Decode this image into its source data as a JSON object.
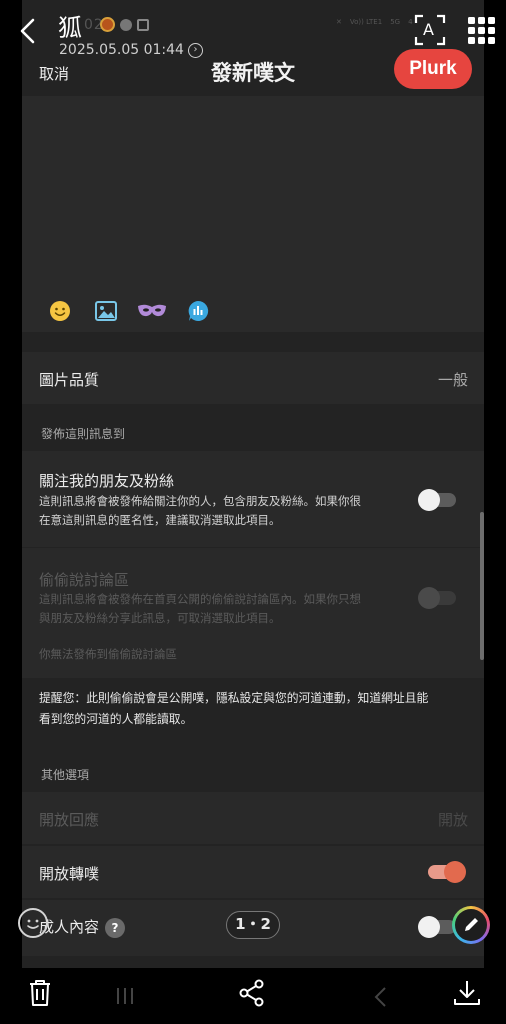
{
  "viewer": {
    "title": "狐",
    "date": "2025.05.05 01:44",
    "ghost_status": "02",
    "ghost_system": [
      "Vo)) LTE1",
      "5G",
      "4"
    ],
    "text_scan_label": "A"
  },
  "composer": {
    "cancel_label": "取消",
    "title": "發新噗文",
    "submit_label": "Plurk",
    "tools": [
      "emoji-icon",
      "image-icon",
      "mask-icon",
      "poll-icon"
    ]
  },
  "settings": {
    "image_quality": {
      "label": "圖片品質",
      "value": "一般"
    },
    "publish_to_header": "發佈這則訊息到",
    "friends_fans": {
      "label": "關注我的朋友及粉絲",
      "desc_1": "這則訊息將會被發佈給關注你的人，包含朋友及粉絲。如果你很",
      "desc_2": "在意這則訊息的匿名性，建議取消選取此項目。",
      "enabled": false
    },
    "anonymous": {
      "label": "偷偷說討論區",
      "desc_1": "這則訊息將會被發佈在首頁公開的偷偷說討論區內。如果你只想",
      "desc_2": "與朋友及粉絲分享此訊息，可取消選取此項目。",
      "unavailable": "你無法發佈到偷偷說討論區",
      "enabled": false
    },
    "notice_1": "提醒您：此則偷偷說會是公開噗，隱私設定與您的河道連動，知道網址且能",
    "notice_2": "看到您的河道的人都能讀取。",
    "other_header": "其他選項",
    "open_response": {
      "label": "開放回應",
      "value": "開放"
    },
    "allow_replurk": {
      "label": "開放轉噗",
      "enabled": true
    },
    "adult_content": {
      "label": "成人內容",
      "help": "?",
      "enabled": false
    }
  },
  "overlay": {
    "page_indicator": "1・2"
  },
  "colors": {
    "accent": "#e6453f",
    "toggle_on": "#e26a4e",
    "panel": "#292929",
    "background": "#232323"
  }
}
